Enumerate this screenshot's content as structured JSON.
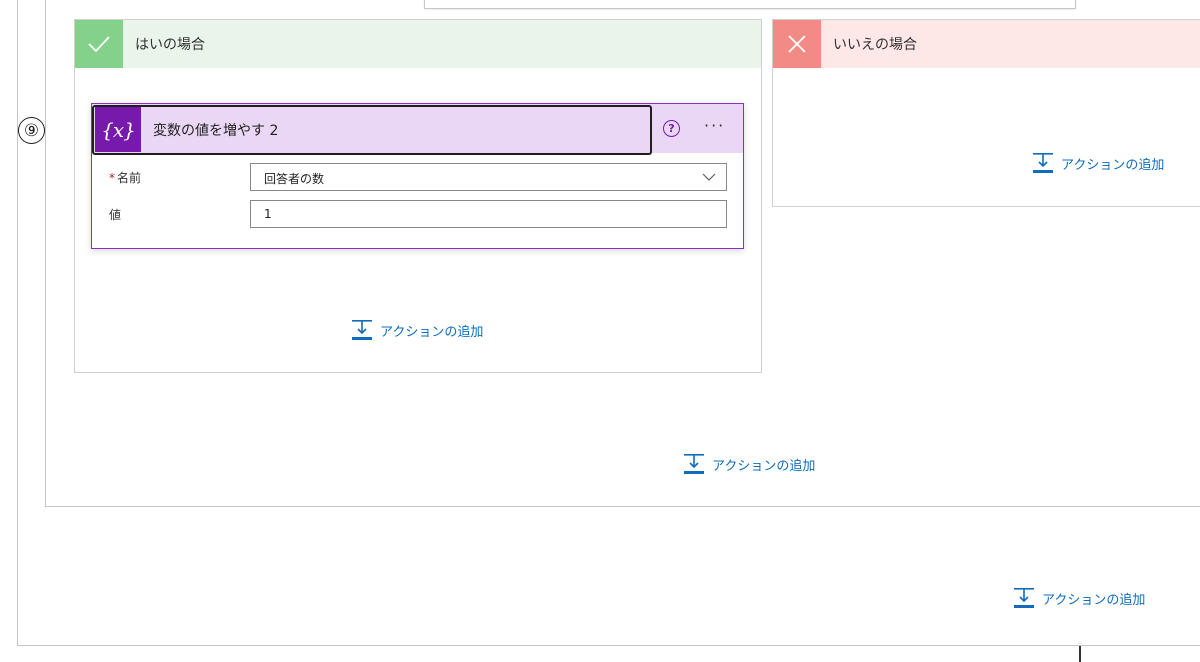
{
  "step_marker": "⑨",
  "branches": {
    "yes": {
      "title": "はいの場合",
      "icon": "check-icon",
      "color": "#84d18a"
    },
    "no": {
      "title": "いいえの場合",
      "icon": "close-icon",
      "color": "#f28b85"
    }
  },
  "action_card": {
    "icon_text": "{x}",
    "title": "変数の値を増やす 2",
    "accent_color": "#7719aa",
    "fields": {
      "name": {
        "label": "名前",
        "required": true,
        "value": "回答者の数"
      },
      "value": {
        "label": "値",
        "value": "1"
      }
    }
  },
  "add_action_label": "アクションの追加"
}
